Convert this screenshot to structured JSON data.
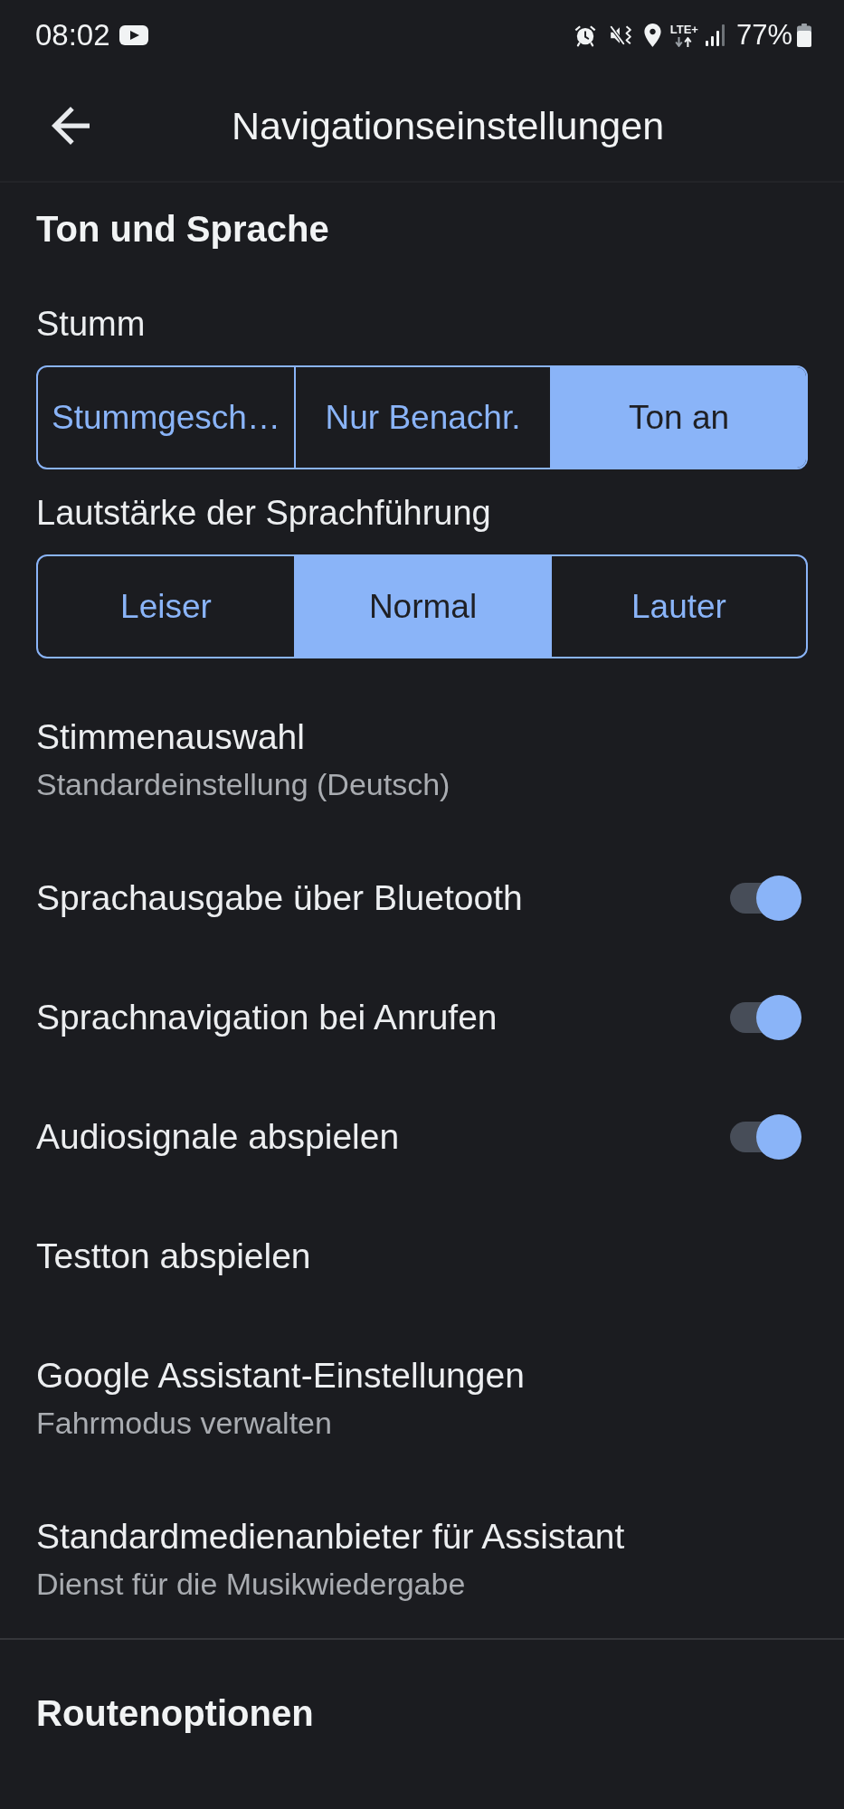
{
  "status_bar": {
    "time": "08:02",
    "network": "LTE+",
    "battery": "77%"
  },
  "app_bar": {
    "title": "Navigationseinstellungen"
  },
  "sections": [
    {
      "title": "Ton und Sprache",
      "items": [
        {
          "kind": "segmented",
          "label": "Stumm",
          "options": [
            {
              "label": "Stummgesch…",
              "selected": false
            },
            {
              "label": "Nur Benachr.",
              "selected": false
            },
            {
              "label": "Ton an",
              "selected": true
            }
          ]
        },
        {
          "kind": "segmented",
          "label": "Lautstärke der Sprachführung",
          "options": [
            {
              "label": "Leiser",
              "selected": false
            },
            {
              "label": "Normal",
              "selected": true
            },
            {
              "label": "Lauter",
              "selected": false
            }
          ]
        },
        {
          "kind": "link",
          "title": "Stimmenauswahl",
          "subtitle": "Standardeinstellung (Deutsch)"
        },
        {
          "kind": "toggle",
          "title": "Sprachausgabe über Bluetooth",
          "on": true
        },
        {
          "kind": "toggle",
          "title": "Sprachnavigation bei Anrufen",
          "on": true
        },
        {
          "kind": "toggle",
          "title": "Audiosignale abspielen",
          "on": true
        },
        {
          "kind": "link",
          "title": "Testton abspielen"
        },
        {
          "kind": "link",
          "title": "Google Assistant-Einstellungen",
          "subtitle": "Fahrmodus verwalten"
        },
        {
          "kind": "link",
          "title": "Standardmedienanbieter für Assistant",
          "subtitle": "Dienst für die Musikwiedergabe"
        }
      ]
    },
    {
      "title": "Routenoptionen"
    }
  ]
}
